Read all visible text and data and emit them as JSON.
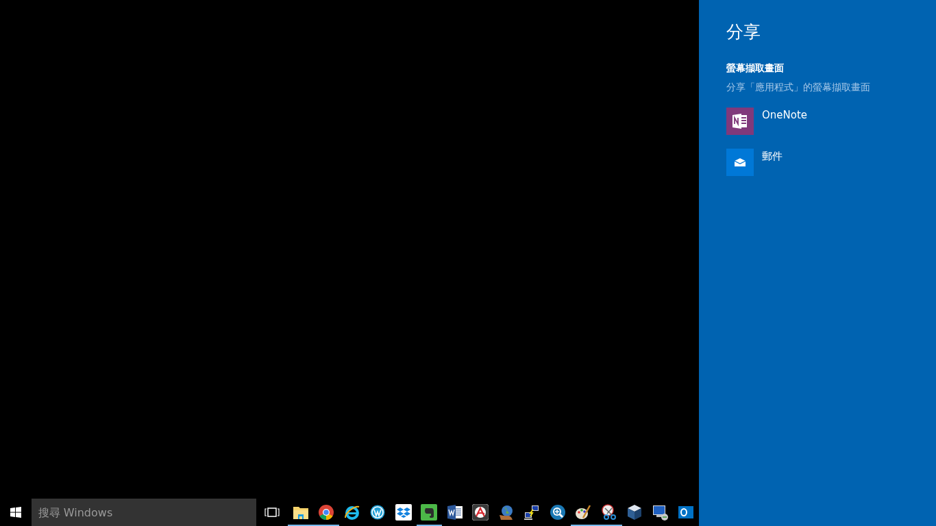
{
  "taskbar": {
    "search": {
      "placeholder": "搜尋 Windows"
    },
    "apps": [
      {
        "kind": "folder",
        "running": true
      },
      {
        "kind": "chrome",
        "running": true
      },
      {
        "kind": "ie",
        "running": false
      },
      {
        "kind": "wordpress",
        "running": false
      },
      {
        "kind": "dropbox",
        "running": false
      },
      {
        "kind": "evernote",
        "running": true
      },
      {
        "kind": "word",
        "running": false
      },
      {
        "kind": "acrobat",
        "running": false
      },
      {
        "kind": "globe",
        "running": false
      },
      {
        "kind": "network",
        "running": false
      },
      {
        "kind": "magnifier",
        "running": false
      },
      {
        "kind": "paint",
        "running": true
      },
      {
        "kind": "scissors",
        "running": true
      },
      {
        "kind": "cube",
        "running": false
      },
      {
        "kind": "remote",
        "running": false
      },
      {
        "kind": "outlook",
        "running": false
      }
    ]
  },
  "share_panel": {
    "title": "分享",
    "subtitle": "螢幕擷取畫面",
    "description": "分享「應用程式」的螢幕擷取畫面",
    "targets": [
      {
        "kind": "onenote",
        "label": "OneNote"
      },
      {
        "kind": "mail",
        "label": "郵件"
      }
    ]
  }
}
